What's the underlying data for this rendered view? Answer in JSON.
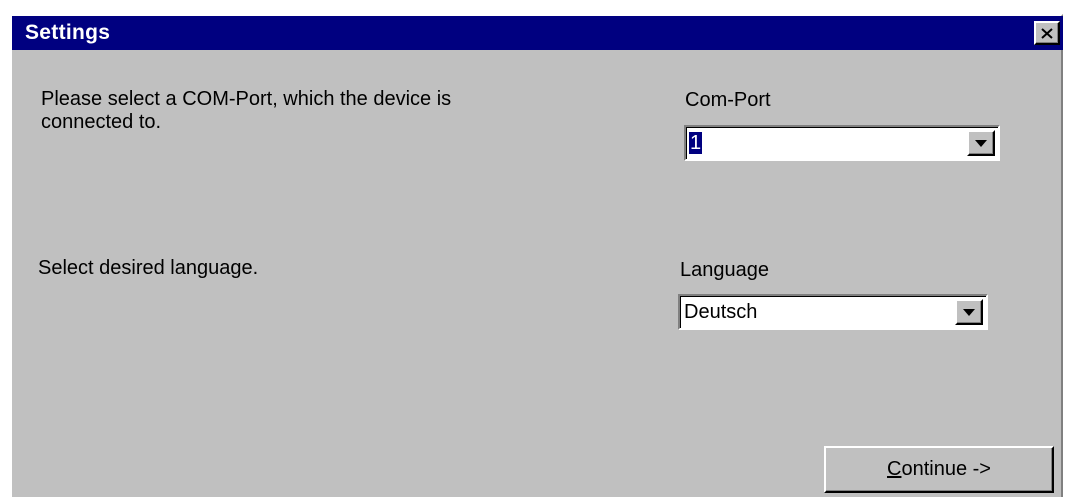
{
  "window": {
    "title": "Settings"
  },
  "com_port": {
    "prompt": "Please select a COM-Port, which the device is",
    "prompt_line2": "connected to.",
    "label": "Com-Port",
    "value": "1"
  },
  "language": {
    "prompt": "Select desired language.",
    "label": "Language",
    "value": "Deutsch"
  },
  "buttons": {
    "continue_accel": "C",
    "continue_rest": "ontinue ->"
  },
  "icons": {
    "close": "close-icon",
    "dropdown": "chevron-down-icon"
  },
  "colors": {
    "titlebar": "#000080",
    "face": "#c0c0c0",
    "selection": "#000080"
  }
}
